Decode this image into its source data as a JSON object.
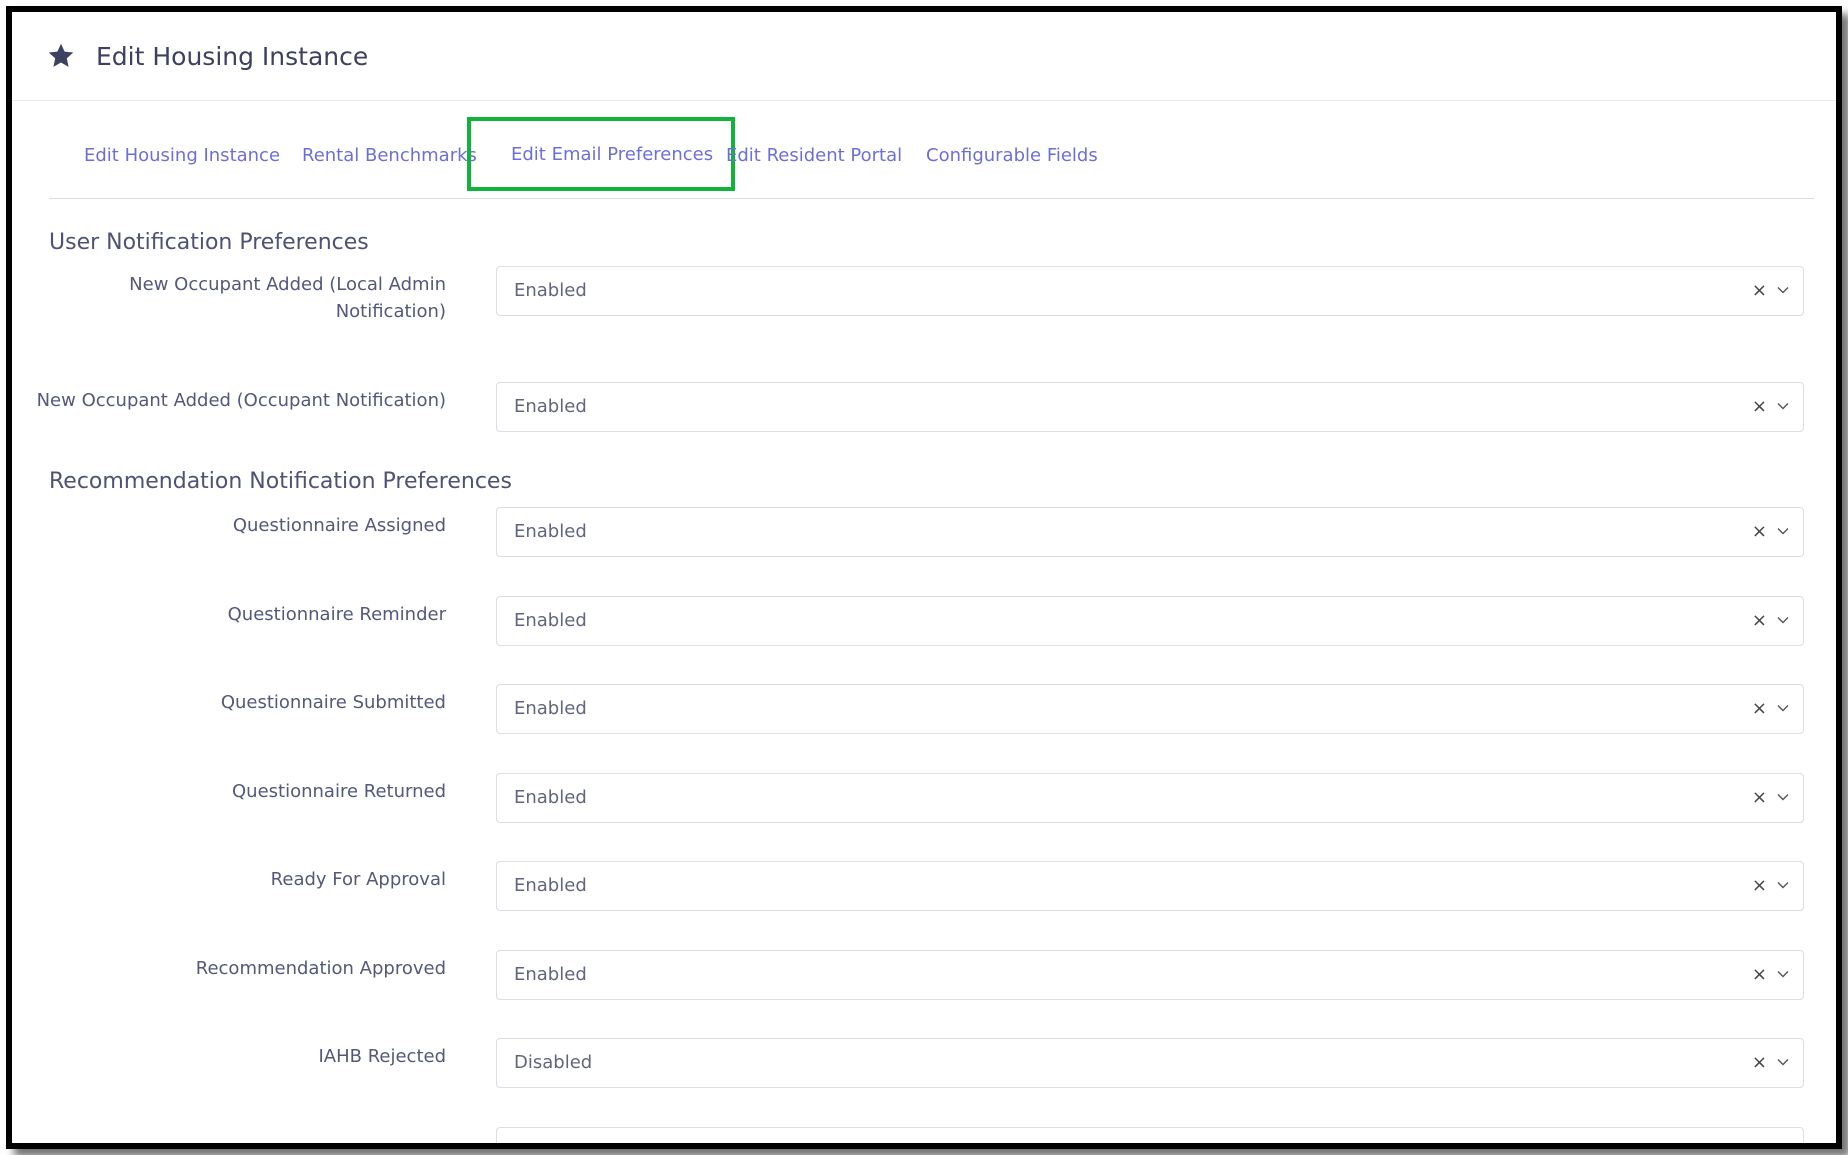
{
  "header": {
    "title": "Edit Housing Instance"
  },
  "tabs": [
    {
      "label": "Edit Housing Instance",
      "active": false
    },
    {
      "label": "Rental Benchmarks",
      "active": false
    },
    {
      "label": "Edit Email Preferences",
      "active": true
    },
    {
      "label": "Edit Resident Portal",
      "active": false
    },
    {
      "label": "Configurable Fields",
      "active": false
    }
  ],
  "sections": {
    "user": {
      "title": "User Notification Preferences",
      "fields": [
        {
          "label": "New Occupant Added (Local Admin Notification)",
          "value": "Enabled"
        },
        {
          "label": "New Occupant Added (Occupant Notification)",
          "value": "Enabled"
        }
      ]
    },
    "recommendation": {
      "title": "Recommendation Notification Preferences",
      "fields": [
        {
          "label": "Questionnaire Assigned",
          "value": "Enabled"
        },
        {
          "label": "Questionnaire Reminder",
          "value": "Enabled"
        },
        {
          "label": "Questionnaire Submitted",
          "value": "Enabled"
        },
        {
          "label": "Questionnaire Returned",
          "value": "Enabled"
        },
        {
          "label": "Ready For Approval",
          "value": "Enabled"
        },
        {
          "label": "Recommendation Approved",
          "value": "Enabled"
        },
        {
          "label": "IAHB Rejected",
          "value": "Disabled"
        }
      ]
    }
  },
  "controls": {
    "clear_glyph": "×"
  },
  "colors": {
    "tab_link": "#6d6fd9",
    "active_tab_outline": "#12b33d"
  },
  "icons": {
    "header": "star-icon",
    "select_clear": "close-icon",
    "select_toggle": "chevron-down-icon"
  }
}
